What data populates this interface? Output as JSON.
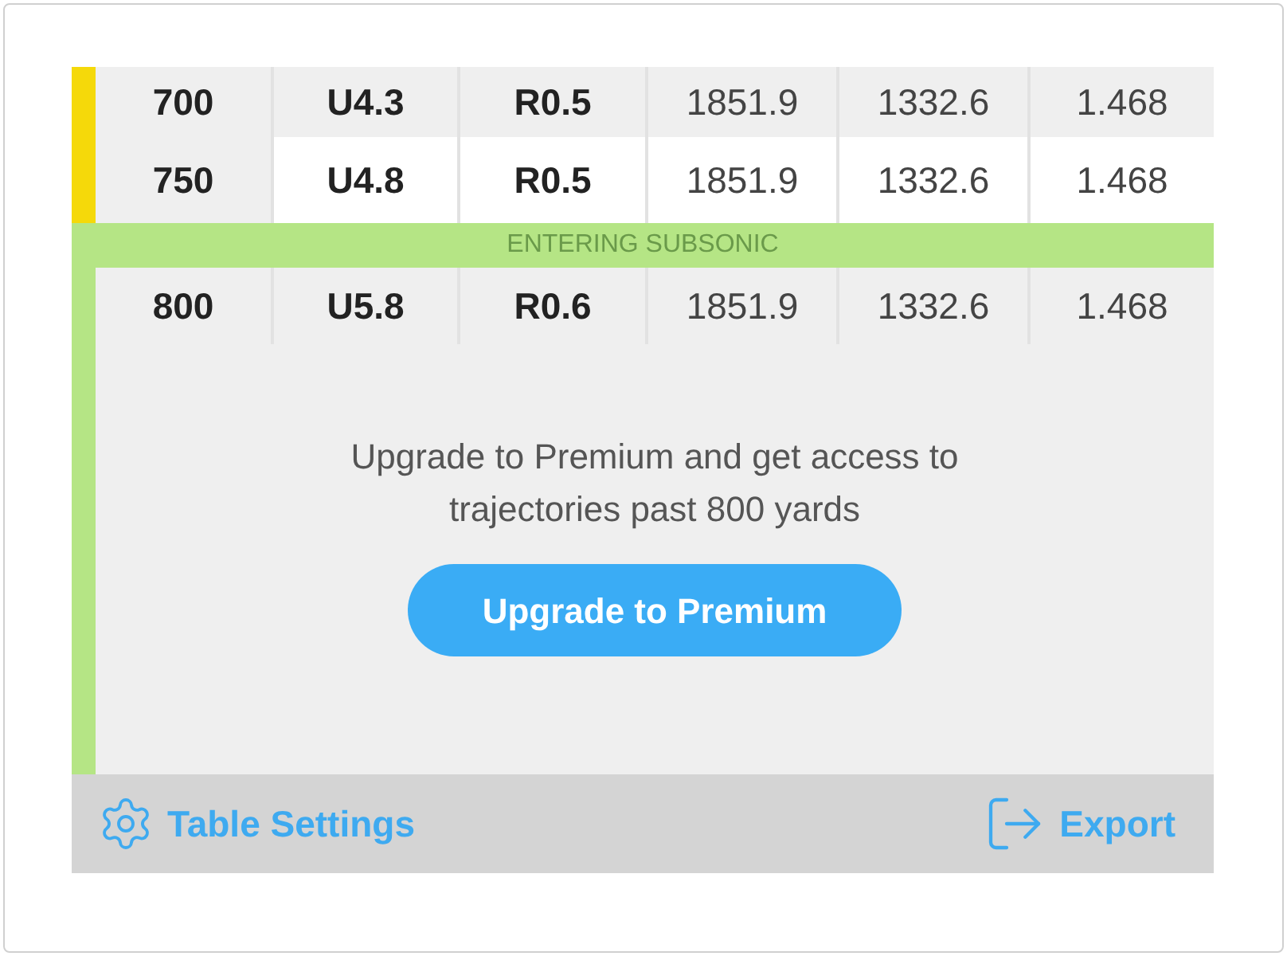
{
  "rows": [
    {
      "kind": "data",
      "color": "#f5d90a",
      "highlighted": false,
      "cells": [
        "700",
        "U4.3",
        "R0.5",
        "1851.9",
        "1332.6",
        "1.468"
      ]
    },
    {
      "kind": "data",
      "color": "#f5d90a",
      "highlighted": true,
      "cells": [
        "750",
        "U4.8",
        "R0.5",
        "1851.9",
        "1332.6",
        "1.468"
      ]
    },
    {
      "kind": "banner",
      "color": "#b5e585",
      "text": "ENTERING SUBSONIC"
    },
    {
      "kind": "data",
      "color": "#b5e585",
      "highlighted": false,
      "cells": [
        "800",
        "U5.8",
        "R0.6",
        "1851.9",
        "1332.6",
        "1.468"
      ]
    }
  ],
  "upgrade": {
    "color": "#b5e585",
    "message": "Upgrade to Premium and get access to trajectories past 800 yards",
    "button": "Upgrade to Premium"
  },
  "footer": {
    "settings_button": "Table Settings",
    "export_button": "Export"
  }
}
